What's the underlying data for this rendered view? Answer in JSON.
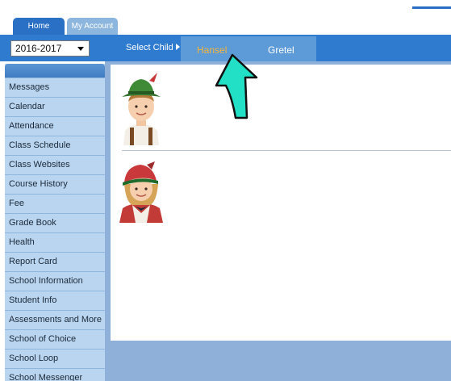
{
  "tabs": {
    "home": "Home",
    "my_account": "My Account"
  },
  "toolbar": {
    "year": "2016-2017",
    "select_child_label": "Select Child",
    "children": [
      "Hansel",
      "Gretel"
    ]
  },
  "sidebar": {
    "items": [
      "Messages",
      "Calendar",
      "Attendance",
      "Class Schedule",
      "Class Websites",
      "Course History",
      "Fee",
      "Grade Book",
      "Health",
      "Report Card",
      "School Information",
      "Student Info",
      "Assessments and More",
      "School of Choice",
      "School Loop",
      "School Messenger"
    ]
  },
  "colors": {
    "tab_active": "#2a70c5",
    "tab_inactive": "#8cb6de",
    "toolbar": "#2f7bd0",
    "selected_child": "#f4b43a",
    "sidebar": "#b9d5ef",
    "arrow": "#22e0c6"
  },
  "icons": {
    "year_dropdown": "chevron-down-icon",
    "select_child": "caret-right-icon",
    "annotation": "up-arrow-icon"
  }
}
